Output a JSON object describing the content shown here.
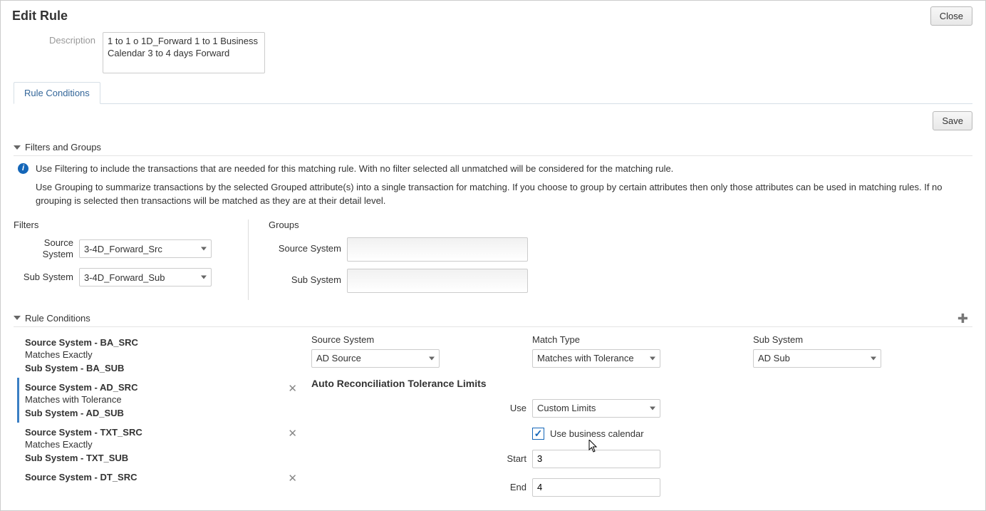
{
  "modal": {
    "title": "Edit Rule",
    "close_label": "Close"
  },
  "description": {
    "label": "Description",
    "value": "1 to 1 o 1D_Forward     1 to 1 Business Calendar 3 to 4 days Forward"
  },
  "tabs": {
    "rule_conditions": "Rule Conditions"
  },
  "buttons": {
    "save": "Save"
  },
  "filters_section": {
    "title": "Filters and Groups",
    "info1": "Use Filtering to include the transactions that are needed for this matching rule. With no filter selected all unmatched will be considered for the matching rule.",
    "info2": "Use Grouping to summarize transactions by the selected Grouped attribute(s) into a single transaction for matching. If you choose to group by certain attributes then only those attributes can be used in matching rules. If no grouping is selected then transactions will be matched as they are at their detail level.",
    "filters_title": "Filters",
    "groups_title": "Groups",
    "labels": {
      "source_system": "Source System",
      "sub_system": "Sub System"
    },
    "source_system_value": "3-4D_Forward_Src",
    "sub_system_value": "3-4D_Forward_Sub"
  },
  "rule_conditions_section": {
    "title": "Rule Conditions"
  },
  "rc_items": [
    {
      "src": "Source System  -  BA_SRC",
      "match": "Matches Exactly",
      "sub": "Sub System  -  BA_SUB",
      "active": false,
      "removable": false
    },
    {
      "src": "Source System  -  AD_SRC",
      "match": "Matches with Tolerance",
      "sub": "Sub System  -  AD_SUB",
      "active": true,
      "removable": true
    },
    {
      "src": "Source System  -  TXT_SRC",
      "match": "Matches Exactly",
      "sub": "Sub System  -  TXT_SUB",
      "active": false,
      "removable": true
    },
    {
      "src": "Source System  -  DT_SRC",
      "match": "",
      "sub": "",
      "active": false,
      "removable": true
    }
  ],
  "rc_detail": {
    "labels": {
      "source_system": "Source System",
      "match_type": "Match Type",
      "sub_system": "Sub System",
      "tolerance_title": "Auto Reconciliation Tolerance Limits",
      "use": "Use",
      "use_business_calendar": "Use business calendar",
      "start": "Start",
      "end": "End"
    },
    "source_system": "AD Source",
    "match_type": "Matches with Tolerance",
    "sub_system": "AD Sub",
    "use_value": "Custom Limits",
    "business_calendar_checked": true,
    "start_value": "3",
    "end_value": "4"
  }
}
